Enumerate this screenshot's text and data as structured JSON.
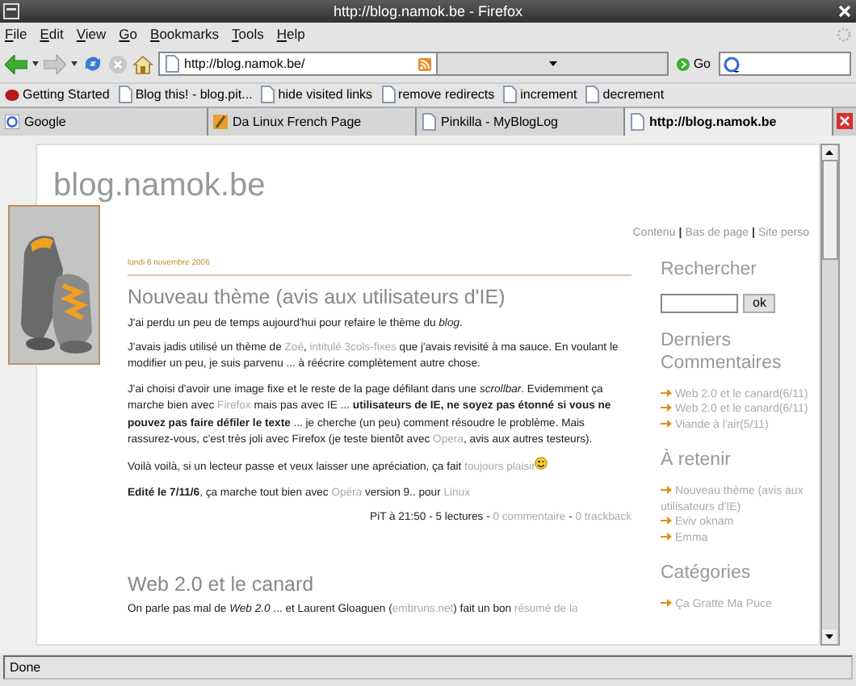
{
  "window": {
    "title": "http://blog.namok.be - Firefox"
  },
  "menu": [
    "File",
    "Edit",
    "View",
    "Go",
    "Bookmarks",
    "Tools",
    "Help"
  ],
  "toolbar": {
    "address": "http://blog.namok.be/",
    "go": "Go"
  },
  "bookmarks": [
    {
      "label": "Getting Started",
      "kind": "start"
    },
    {
      "label": "Blog this! - blog.pit...",
      "kind": "page"
    },
    {
      "label": "hide visited links",
      "kind": "page"
    },
    {
      "label": "remove redirects",
      "kind": "page"
    },
    {
      "label": "increment",
      "kind": "page"
    },
    {
      "label": "decrement",
      "kind": "page"
    }
  ],
  "tabs": [
    {
      "label": "Google",
      "kind": "google",
      "selected": false
    },
    {
      "label": "Da Linux French Page",
      "kind": "linux",
      "selected": false
    },
    {
      "label": "Pinkilla - MyBlogLog",
      "kind": "page",
      "selected": false
    },
    {
      "label": "http://blog.namok.be",
      "kind": "page",
      "selected": true
    }
  ],
  "page": {
    "title": "blog.namok.be",
    "links": [
      {
        "text": "Contenu",
        "kind": "link"
      },
      {
        "text": "|",
        "kind": "sep"
      },
      {
        "text": "Bas de page",
        "kind": "link"
      },
      {
        "text": "|",
        "kind": "sep"
      },
      {
        "text": "Site perso",
        "kind": "link"
      }
    ],
    "posts": [
      {
        "date": "lundi 6 novembre 2006",
        "title": "Nouveau thème (avis aux utilisateurs d'IE)",
        "paragraphs": [
          [
            "J'ai perdu un peu de temps aujourd'hui pour refaire le thème du ",
            {
              "kind": "italic",
              "text": "blog"
            },
            "."
          ],
          [
            "J'avais jadis utilisé un thème de ",
            {
              "kind": "link",
              "text": "Zoé"
            },
            ", ",
            {
              "kind": "link",
              "text": "intitulé 3cols-fixes"
            },
            " que j'avais revisité à ma sauce. En voulant le modifier un peu, je suis parvenu ... à réécrire complètement autre chose."
          ],
          [
            "J'ai choisi d'avoir une image fixe et le reste de la page défilant dans une ",
            {
              "kind": "italic",
              "text": "scrollbar"
            },
            ". Evidemment ça marche bien avec ",
            {
              "kind": "link",
              "text": "Firefox"
            },
            " mais pas avec IE ... ",
            {
              "kind": "bold",
              "text": "utilisateurs de IE, ne soyez pas étonné si vous ne pouvez pas faire défiler le texte"
            },
            " ... je cherche (un peu) comment résoudre le problème. Mais rassurez-vous, c'est très joli avec Firefox (je teste bientôt avec ",
            {
              "kind": "link",
              "text": "Opera"
            },
            ", avis aux autres testeurs)."
          ],
          [
            "Voilà voilà, si un lecteur passe et veux laisser une apréciation, ça fait ",
            {
              "kind": "link",
              "text": "toujours plaisir"
            },
            {
              "kind": "smiley"
            }
          ],
          [
            {
              "kind": "bold",
              "text": "Edité le 7/11/6"
            },
            ", ça marche tout bien avec ",
            {
              "kind": "link",
              "text": "Opéra"
            },
            " version 9.. pour ",
            {
              "kind": "link",
              "text": "Linux"
            }
          ]
        ],
        "footer": [
          "PiT à 21:50 - 5 lectures - ",
          {
            "kind": "link",
            "text": "0 commentaire"
          },
          " - ",
          {
            "kind": "link",
            "text": "0 trackback"
          }
        ]
      },
      {
        "title": "Web 2.0 et le canard",
        "paragraphs": [
          [
            "On parle pas mal de ",
            {
              "kind": "italic",
              "text": "Web 2.0"
            },
            " ... et Laurent Gloaguen (",
            {
              "kind": "link",
              "text": "embruns.net"
            },
            ") fait un bon ",
            {
              "kind": "link",
              "text": "résumé de la"
            }
          ]
        ]
      }
    ]
  },
  "sidebar": [
    {
      "kind": "search",
      "title": "Rechercher",
      "button": "ok"
    },
    {
      "kind": "list",
      "title": "Derniers Commentaires",
      "items": [
        "Web 2.0 et le canard(6/11)",
        "Web 2.0 et le canard(6/11)",
        "Viande à l'air(5/11)"
      ]
    },
    {
      "kind": "list",
      "title": "À retenir",
      "items": [
        "Nouveau thème (avis aux utilisateurs d'IE)",
        "Eviv oknam",
        "Emma"
      ]
    },
    {
      "kind": "list",
      "title": "Catégories",
      "items": [
        "Ça Gratte Ma Puce"
      ]
    }
  ],
  "status": "Done"
}
